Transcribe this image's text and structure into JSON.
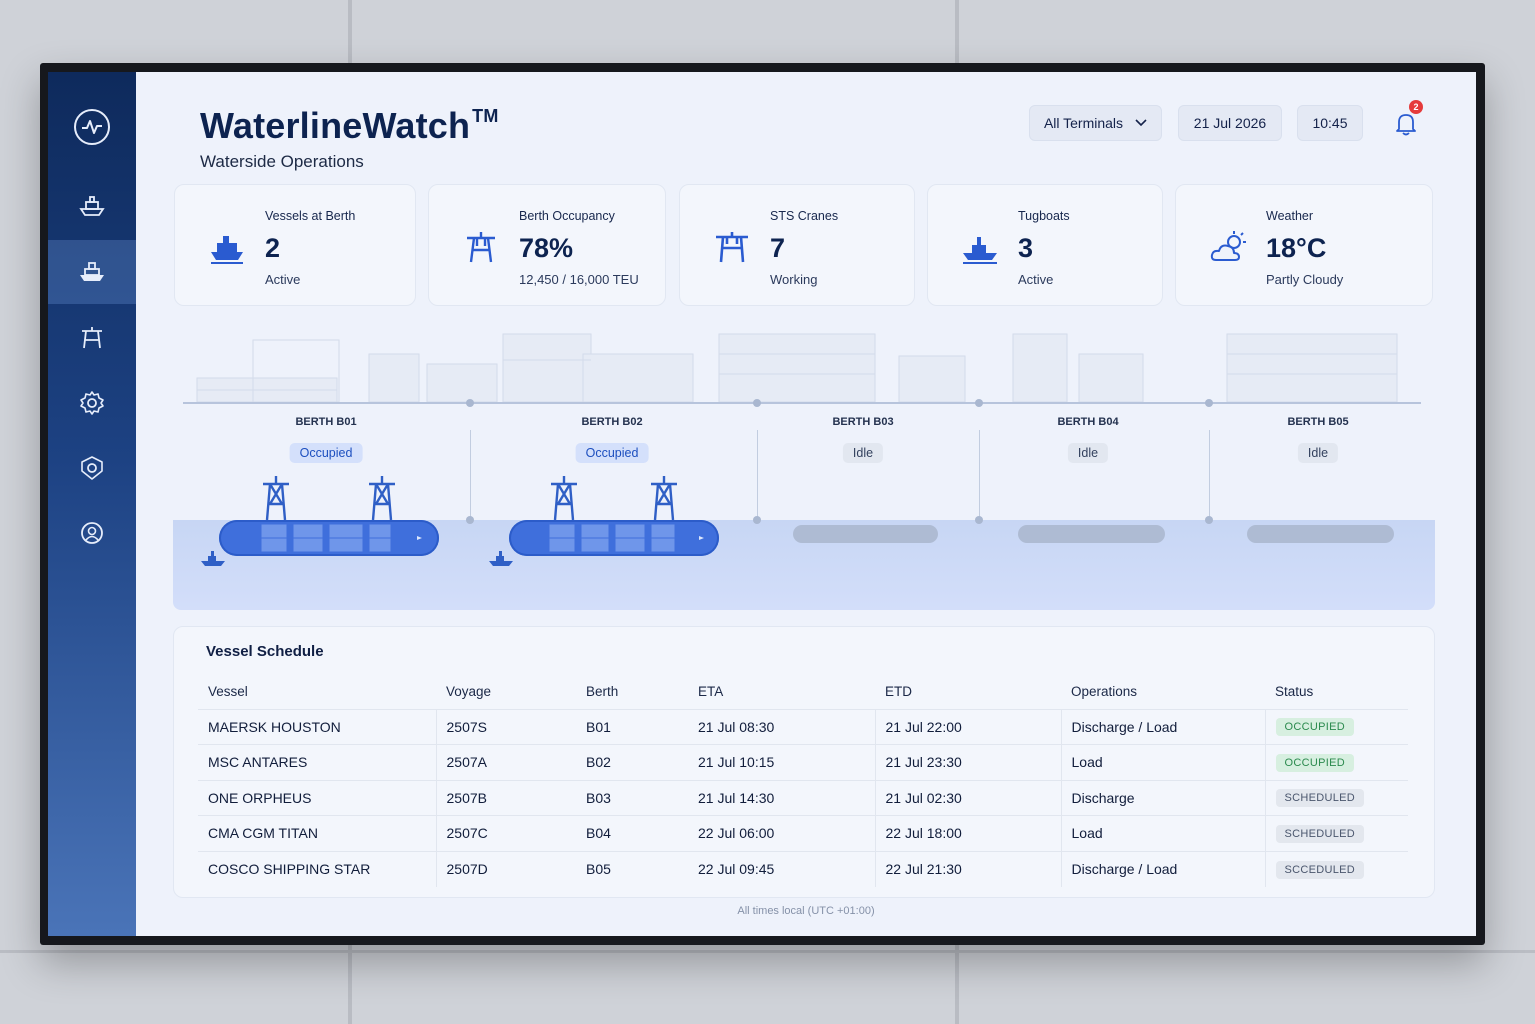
{
  "app": {
    "title": "WaterlineWatch",
    "trademark": "TM",
    "subtitle": "Waterside Operations"
  },
  "header": {
    "terminal_filter": "All Terminals",
    "date": "21 Jul 2026",
    "time": "10:45",
    "notification_count": "2"
  },
  "sidebar": {
    "items": [
      {
        "icon": "ship-icon"
      },
      {
        "icon": "vessel-icon",
        "active": true
      },
      {
        "icon": "crane-icon"
      },
      {
        "icon": "gear-icon"
      },
      {
        "icon": "settings-shield-icon"
      },
      {
        "icon": "support-icon"
      }
    ]
  },
  "kpis": [
    {
      "label": "Vessels at Berth",
      "value": "2",
      "sub": "Active",
      "icon": "ship-icon"
    },
    {
      "label": "Berth Occupancy",
      "value": "78%",
      "sub": "12,450 / 16,000 TEU",
      "icon": "crane-icon"
    },
    {
      "label": "STS Cranes",
      "value": "7",
      "sub": "Working",
      "icon": "sts-crane-icon"
    },
    {
      "label": "Tugboats",
      "value": "3",
      "sub": "Active",
      "icon": "tugboat-icon"
    },
    {
      "label": "Weather",
      "value": "18°C",
      "sub": "Partly Cloudy",
      "icon": "partly-cloudy-icon"
    }
  ],
  "berths": [
    {
      "label": "BERTH B01",
      "status": "Occupied"
    },
    {
      "label": "BERTH B02",
      "status": "Occupied"
    },
    {
      "label": "BERTH B03",
      "status": "Idle"
    },
    {
      "label": "BERTH B04",
      "status": "Idle"
    },
    {
      "label": "BERTH B05",
      "status": "Idle"
    }
  ],
  "schedule": {
    "title": "Vessel Schedule",
    "columns": [
      "Vessel",
      "Voyage",
      "Berth",
      "ETA",
      "ETD",
      "Operations",
      "Status"
    ],
    "rows": [
      {
        "vessel": "MAERSK HOUSTON",
        "voyage": "2507S",
        "berth": "B01",
        "eta": "21 Jul 08:30",
        "etd": "21 Jul 22:00",
        "ops": "Discharge / Load",
        "status": "OCCUPIED"
      },
      {
        "vessel": "MSC ANTARES",
        "voyage": "2507A",
        "berth": "B02",
        "eta": "21 Jul 10:15",
        "etd": "21 Jul 23:30",
        "ops": "Load",
        "status": "OCCUPIED"
      },
      {
        "vessel": "ONE ORPHEUS",
        "voyage": "2507B",
        "berth": "B03",
        "eta": "21 Jul 14:30",
        "etd": "21 Jul 02:30",
        "ops": "Discharge",
        "status": "SCHEDULED"
      },
      {
        "vessel": "CMA CGM TITAN",
        "voyage": "2507C",
        "berth": "B04",
        "eta": "22 Jul 06:00",
        "etd": "22 Jul 18:00",
        "ops": "Load",
        "status": "SCHEDULED"
      },
      {
        "vessel": "COSCO SHIPPING STAR",
        "voyage": "2507D",
        "berth": "B05",
        "eta": "22 Jul 09:45",
        "etd": "22 Jul 21:30",
        "ops": "Discharge / Load",
        "status": "SCCEDULED"
      }
    ]
  },
  "footer": "All times local (UTC +01:00)",
  "colors": {
    "accent": "#3f6fdc",
    "navy": "#0d2350",
    "occupied_bg": "#d7efe0",
    "occupied_text": "#2b8a4e",
    "notification": "#e53b3b"
  }
}
